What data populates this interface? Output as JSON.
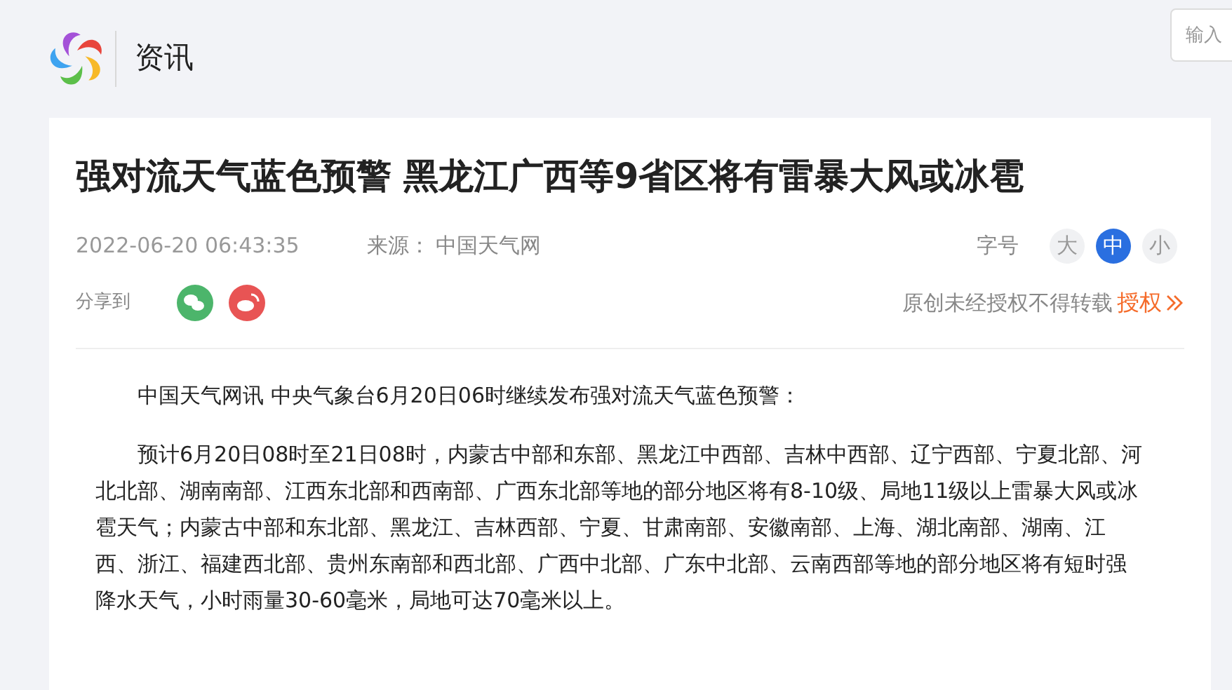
{
  "header": {
    "section": "资讯",
    "search": {
      "placeholder": "输入"
    }
  },
  "article": {
    "title": "强对流天气蓝色预警 黑龙江广西等9省区将有雷暴大风或冰雹",
    "date": "2022-06-20 06:43:35",
    "source_label": "来源：",
    "source": "中国天气网",
    "font_size_label": "字号",
    "font_sizes": [
      {
        "label": "大",
        "selected": false
      },
      {
        "label": "中",
        "selected": true
      },
      {
        "label": "小",
        "selected": false
      }
    ],
    "share_label": "分享到",
    "share": [
      {
        "kind": "wechat",
        "color": "#4cb56b"
      },
      {
        "kind": "weibo",
        "color": "#e85454"
      }
    ],
    "copyright": "原创未经授权不得转载",
    "license_link": "授权",
    "paragraphs": [
      "中国天气网讯 中央气象台6月20日06时继续发布强对流天气蓝色预警：",
      "预计6月20日08时至21日08时，内蒙古中部和东部、黑龙江中西部、吉林中西部、辽宁西部、宁夏北部、河北北部、湖南南部、江西东北部和西南部、广西东北部等地的部分地区将有8-10级、局地11级以上雷暴大风或冰雹天气；内蒙古中部和东北部、黑龙江、吉林西部、宁夏、甘肃南部、安徽南部、上海、湖北南部、湖南、江西、浙江、福建西北部、贵州东南部和西北部、广西中北部、广东中北部、云南西部等地的部分地区将有短时强降水天气，小时雨量30-60毫米，局地可达70毫米以上。"
    ]
  }
}
